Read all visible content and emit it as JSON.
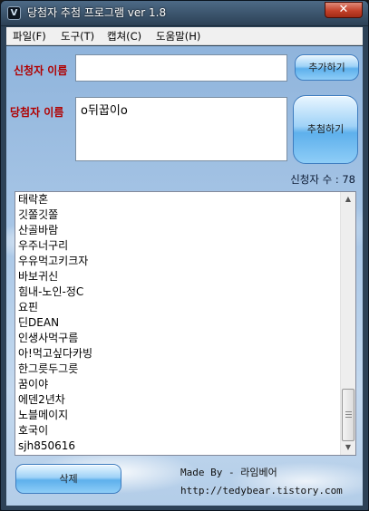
{
  "window": {
    "title": "당첨자 추첨 프로그램 ver 1.8",
    "close_symbol": "✕"
  },
  "menu": [
    {
      "label": "파일(F)"
    },
    {
      "label": "도구(T)"
    },
    {
      "label": "캡쳐(C)"
    },
    {
      "label": "도움말(H)"
    }
  ],
  "form": {
    "applicant_label": "신청자 이름",
    "applicant_value": "",
    "add_button": "추가하기",
    "winner_label": "당첨자 이름",
    "winner_value": "o뒤꿉이o",
    "draw_button": "추첨하기",
    "count_label": "신청자 수 : 78"
  },
  "list": {
    "items": [
      "태락혼",
      "깃쫄깃쫄",
      "산골바람",
      "우주너구리",
      "우유먹고키크자",
      "바보귀신",
      "힘내-노인-정C",
      "요핀",
      "딘DEAN",
      "인생사먹구름",
      "아!먹고싶다카빙",
      "한그릇두그릇",
      "꿈이야",
      "에덴2년차",
      "노블메이지",
      "호국이",
      "sjh850616"
    ],
    "scroll_up": "▲",
    "scroll_down": "▼"
  },
  "footer": {
    "delete_button": "삭제",
    "made_by": "Made By - 라임베어",
    "url": "http://tedybear.tistory.com"
  },
  "colors": {
    "label_red": "#b00000",
    "button_blue": "#5eb0ec"
  }
}
